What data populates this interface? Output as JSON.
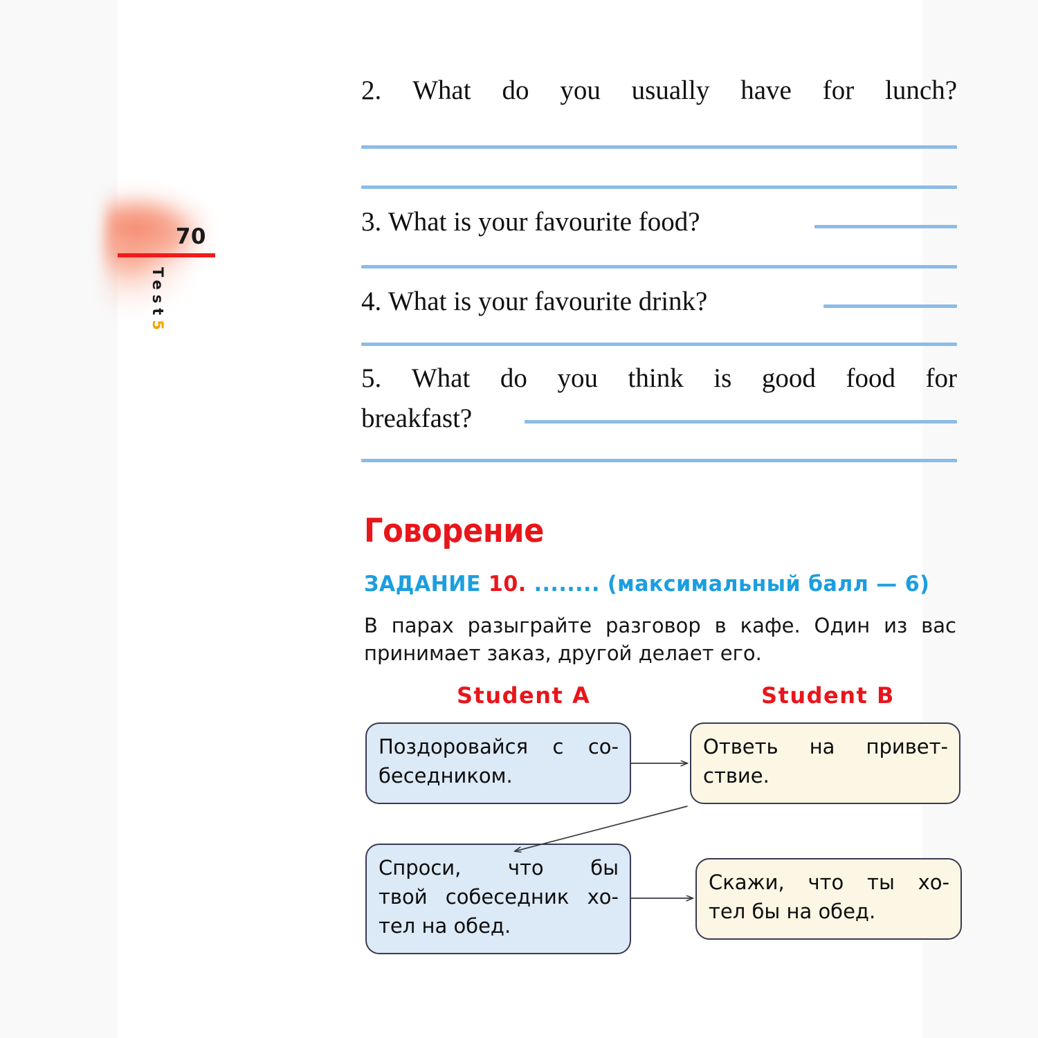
{
  "page": {
    "number": "70",
    "vertical_label": "Test",
    "vertical_number": "5",
    "rule_color": "#ee1c1c",
    "accent_orange": "#f5a400"
  },
  "questions": [
    {
      "id": "q2",
      "number": "2.",
      "text": "What do you usually have for lunch?"
    },
    {
      "id": "q3",
      "number": "3.",
      "text": "What is your favourite food?"
    },
    {
      "id": "q4",
      "number": "4.",
      "text": "What is your favourite drink?"
    },
    {
      "id": "q5",
      "number": "5.",
      "text": "What do you think is good food for",
      "text_line2": "breakfast?"
    }
  ],
  "speaking": {
    "title": "Говорение",
    "title_color": "#e8161b",
    "task_label": "ЗАДАНИЕ",
    "task_number": "10.",
    "task_dots": "........",
    "task_points": "(максимальный балл — 6)",
    "task_color": "#1b9ee0",
    "description_line1": "В парах разыграйте разговор в кафе. Один из вас",
    "description_line2": "принимает заказ, другой делает его.",
    "student_a": "Student A",
    "student_b": "Student B",
    "boxes": {
      "a1_line1": "Поздоровайся с со-",
      "a1_line2": "беседником.",
      "b1_line1": "Ответь на привет-",
      "b1_line2": "ствие.",
      "a2_line1": "Спроси, что бы",
      "a2_line2": "твой собеседник хо-",
      "a2_line3": "тел на обед.",
      "b2_line1": "Скажи, что ты хо-",
      "b2_line2": "тел бы на обед."
    },
    "box_blue_fill": "#dce9f6",
    "box_cream_fill": "#fcf6e4",
    "box_border": "#3a3a52"
  },
  "answer_line_color": "#8bbce8"
}
